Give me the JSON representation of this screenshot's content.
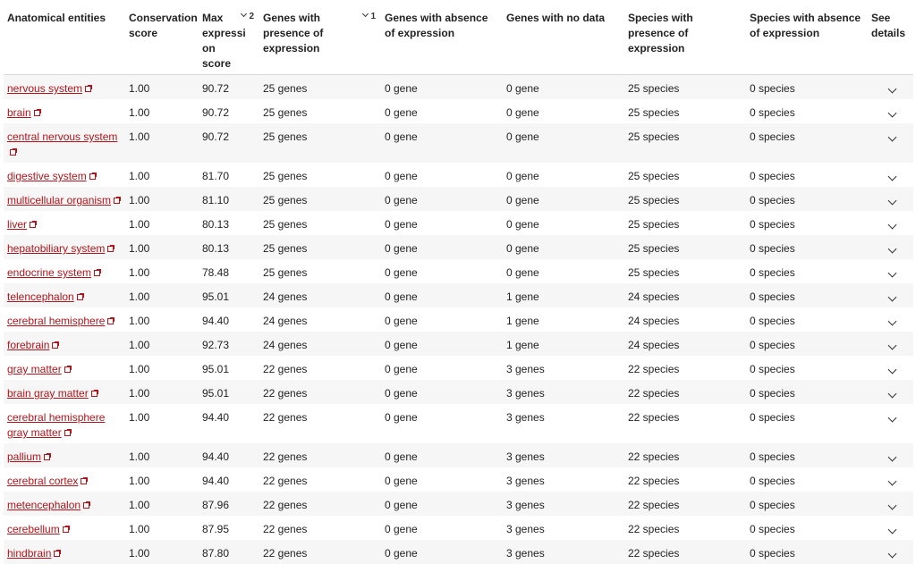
{
  "headers": {
    "entity": "Anatomical entities",
    "conservation": "Conservation score",
    "maxexpr": "Max expressi on score",
    "maxexpr_sort": "2",
    "presence": "Genes with presence of expression",
    "presence_sort": "1",
    "absence": "Genes with absence of expression",
    "nodata": "Genes with no data",
    "sp_presence": "Species with presence of expression",
    "sp_absence": "Species with absence of expression",
    "details": "See details"
  },
  "rows": [
    {
      "name": "nervous system",
      "score": "1.00",
      "max": "90.72",
      "pres": "25 genes",
      "abs": "0 gene",
      "nod": "0 gene",
      "spp": "25 species",
      "spa": "0 species"
    },
    {
      "name": "brain",
      "score": "1.00",
      "max": "90.72",
      "pres": "25 genes",
      "abs": "0 gene",
      "nod": "0 gene",
      "spp": "25 species",
      "spa": "0 species"
    },
    {
      "name": "central nervous system",
      "score": "1.00",
      "max": "90.72",
      "pres": "25 genes",
      "abs": "0 gene",
      "nod": "0 gene",
      "spp": "25 species",
      "spa": "0 species"
    },
    {
      "name": "digestive system",
      "score": "1.00",
      "max": "81.70",
      "pres": "25 genes",
      "abs": "0 gene",
      "nod": "0 gene",
      "spp": "25 species",
      "spa": "0 species"
    },
    {
      "name": "multicellular organism",
      "score": "1.00",
      "max": "81.10",
      "pres": "25 genes",
      "abs": "0 gene",
      "nod": "0 gene",
      "spp": "25 species",
      "spa": "0 species"
    },
    {
      "name": "liver",
      "score": "1.00",
      "max": "80.13",
      "pres": "25 genes",
      "abs": "0 gene",
      "nod": "0 gene",
      "spp": "25 species",
      "spa": "0 species"
    },
    {
      "name": "hepatobiliary system",
      "score": "1.00",
      "max": "80.13",
      "pres": "25 genes",
      "abs": "0 gene",
      "nod": "0 gene",
      "spp": "25 species",
      "spa": "0 species"
    },
    {
      "name": "endocrine system",
      "score": "1.00",
      "max": "78.48",
      "pres": "25 genes",
      "abs": "0 gene",
      "nod": "0 gene",
      "spp": "25 species",
      "spa": "0 species"
    },
    {
      "name": "telencephalon",
      "score": "1.00",
      "max": "95.01",
      "pres": "24 genes",
      "abs": "0 gene",
      "nod": "1 gene",
      "spp": "24 species",
      "spa": "0 species"
    },
    {
      "name": "cerebral hemisphere",
      "score": "1.00",
      "max": "94.40",
      "pres": "24 genes",
      "abs": "0 gene",
      "nod": "1 gene",
      "spp": "24 species",
      "spa": "0 species"
    },
    {
      "name": "forebrain",
      "score": "1.00",
      "max": "92.73",
      "pres": "24 genes",
      "abs": "0 gene",
      "nod": "1 gene",
      "spp": "24 species",
      "spa": "0 species"
    },
    {
      "name": "gray matter",
      "score": "1.00",
      "max": "95.01",
      "pres": "22 genes",
      "abs": "0 gene",
      "nod": "3 genes",
      "spp": "22 species",
      "spa": "0 species"
    },
    {
      "name": "brain gray matter",
      "score": "1.00",
      "max": "95.01",
      "pres": "22 genes",
      "abs": "0 gene",
      "nod": "3 genes",
      "spp": "22 species",
      "spa": "0 species"
    },
    {
      "name": "cerebral hemisphere gray matter",
      "score": "1.00",
      "max": "94.40",
      "pres": "22 genes",
      "abs": "0 gene",
      "nod": "3 genes",
      "spp": "22 species",
      "spa": "0 species"
    },
    {
      "name": "pallium",
      "score": "1.00",
      "max": "94.40",
      "pres": "22 genes",
      "abs": "0 gene",
      "nod": "3 genes",
      "spp": "22 species",
      "spa": "0 species"
    },
    {
      "name": "cerebral cortex",
      "score": "1.00",
      "max": "94.40",
      "pres": "22 genes",
      "abs": "0 gene",
      "nod": "3 genes",
      "spp": "22 species",
      "spa": "0 species"
    },
    {
      "name": "metencephalon",
      "score": "1.00",
      "max": "87.96",
      "pres": "22 genes",
      "abs": "0 gene",
      "nod": "3 genes",
      "spp": "22 species",
      "spa": "0 species"
    },
    {
      "name": "cerebellum",
      "score": "1.00",
      "max": "87.95",
      "pres": "22 genes",
      "abs": "0 gene",
      "nod": "3 genes",
      "spp": "22 species",
      "spa": "0 species"
    },
    {
      "name": "hindbrain",
      "score": "1.00",
      "max": "87.80",
      "pres": "22 genes",
      "abs": "0 gene",
      "nod": "3 genes",
      "spp": "22 species",
      "spa": "0 species"
    }
  ],
  "icons": {
    "external_link": "external-link-icon",
    "expand": "chevron-down-icon",
    "sort": "chevron-down-icon"
  },
  "colors": {
    "link": "#b1151c",
    "stripe": "#f6f6f6"
  }
}
